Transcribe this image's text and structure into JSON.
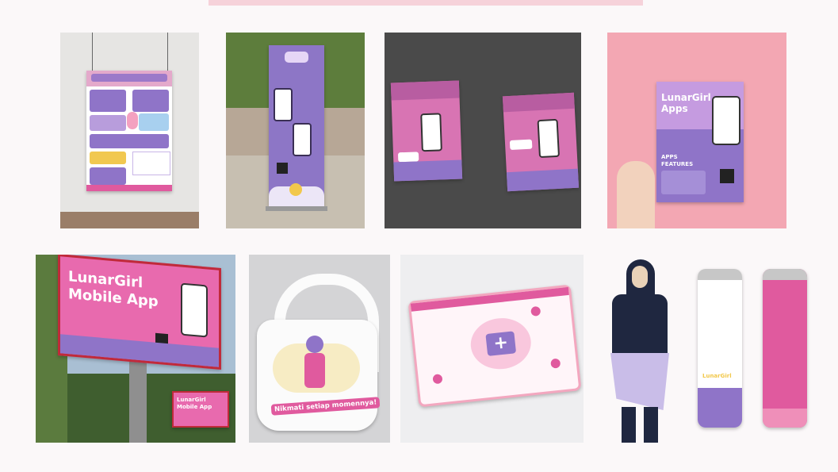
{
  "billboard": {
    "title_line1": "LunarGirl",
    "title_line2": "Mobile App"
  },
  "small_billboard": {
    "title_line1": "LunarGirl",
    "title_line2": "Mobile App"
  },
  "flyer": {
    "title_line1": "LunarGirl",
    "title_line2": "Apps",
    "features_line1": "APPS",
    "features_line2": "FEATURES"
  },
  "tote_bag": {
    "slogan": "Nikmati setiap momennya!"
  },
  "bottle": {
    "logo": "LunarGirl"
  },
  "colors": {
    "primary_purple": "#8f74c8",
    "pink": "#e05a9e",
    "light_pink": "#f3a7bf",
    "background": "#fbf8f9"
  }
}
